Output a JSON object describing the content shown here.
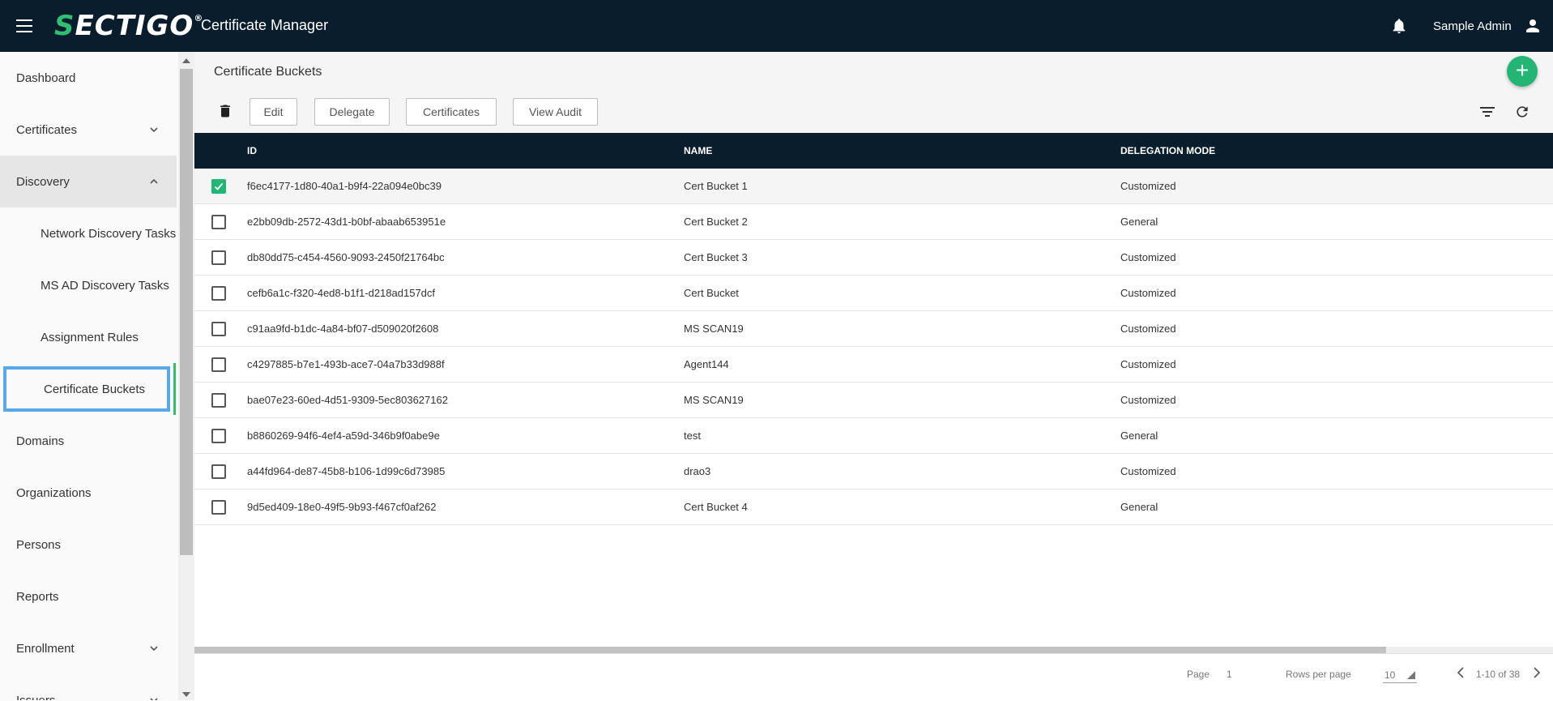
{
  "header": {
    "logo_main": "ECTIGO",
    "logo_s": "S",
    "logo_mark": "®",
    "app_title": "Certificate Manager",
    "user_name": "Sample Admin"
  },
  "sidebar": {
    "items": [
      {
        "label": "Dashboard"
      },
      {
        "label": "Certificates"
      },
      {
        "label": "Discovery"
      },
      {
        "label": "Network Discovery Tasks"
      },
      {
        "label": "MS AD Discovery Tasks"
      },
      {
        "label": "Assignment Rules"
      },
      {
        "label": "Certificate Buckets"
      },
      {
        "label": "Domains"
      },
      {
        "label": "Organizations"
      },
      {
        "label": "Persons"
      },
      {
        "label": "Reports"
      },
      {
        "label": "Enrollment"
      },
      {
        "label": "Issuers"
      }
    ]
  },
  "page": {
    "title": "Certificate Buckets",
    "fab": "+"
  },
  "toolbar": {
    "edit": "Edit",
    "delegate": "Delegate",
    "certificates": "Certificates",
    "view_audit": "View Audit"
  },
  "table": {
    "columns": {
      "id": "ID",
      "name": "NAME",
      "mode": "DELEGATION MODE"
    },
    "rows": [
      {
        "id": "f6ec4177-1d80-40a1-b9f4-22a094e0bc39",
        "name": "Cert Bucket 1",
        "mode": "Customized",
        "checked": true
      },
      {
        "id": "e2bb09db-2572-43d1-b0bf-abaab653951e",
        "name": "Cert Bucket 2",
        "mode": "General",
        "checked": false
      },
      {
        "id": "db80dd75-c454-4560-9093-2450f21764bc",
        "name": "Cert Bucket 3",
        "mode": "Customized",
        "checked": false
      },
      {
        "id": "cefb6a1c-f320-4ed8-b1f1-d218ad157dcf",
        "name": "Cert Bucket",
        "mode": "Customized",
        "checked": false
      },
      {
        "id": "c91aa9fd-b1dc-4a84-bf07-d509020f2608",
        "name": "MS SCAN19",
        "mode": "Customized",
        "checked": false
      },
      {
        "id": "c4297885-b7e1-493b-ace7-04a7b33d988f",
        "name": "Agent144",
        "mode": "Customized",
        "checked": false
      },
      {
        "id": "bae07e23-60ed-4d51-9309-5ec803627162",
        "name": "MS SCAN19",
        "mode": "Customized",
        "checked": false
      },
      {
        "id": "b8860269-94f6-4ef4-a59d-346b9f0abe9e",
        "name": "test",
        "mode": "General",
        "checked": false
      },
      {
        "id": "a44fd964-de87-45b8-b106-1d99c6d73985",
        "name": "drao3",
        "mode": "Customized",
        "checked": false
      },
      {
        "id": "9d5ed409-18e0-49f5-9b93-f467cf0af262",
        "name": "Cert Bucket 4",
        "mode": "General",
        "checked": false
      }
    ]
  },
  "footer": {
    "page_label": "Page",
    "page_value": "1",
    "rows_label": "Rows per page",
    "rows_value": "10",
    "range": "1-10 of 38"
  },
  "icons": [
    "menu-icon",
    "bell-icon",
    "user-icon",
    "chevron-down-icon",
    "chevron-up-icon",
    "trash-icon",
    "filter-icon",
    "refresh-icon",
    "chevron-left-icon",
    "chevron-right-icon",
    "check-icon"
  ],
  "colors": {
    "topbar": "#0a1d2c",
    "accent": "#22b573",
    "active_outline": "#5aa9e6"
  }
}
